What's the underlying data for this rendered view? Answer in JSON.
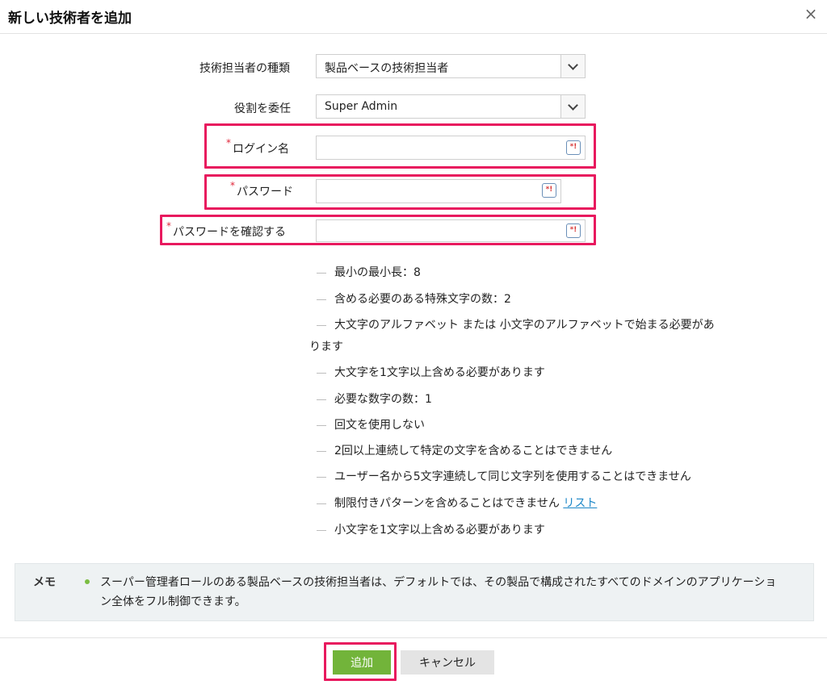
{
  "dialog": {
    "title": "新しい技術者を追加",
    "close_label": "×"
  },
  "form": {
    "tech_type_label": "技術担当者の種類",
    "tech_type_value": "製品ベースの技術担当者",
    "role_label": "役割を委任",
    "role_value": "Super Admin",
    "login_label": "ログイン名",
    "password_label": "パスワード",
    "confirm_label": "パスワードを確認する",
    "required_mark": "*",
    "key_icon_glyph": "*!"
  },
  "rules": [
    "最小の最小長：8",
    "含める必要のある特殊文字の数：2",
    "大文字のアルファベット または 小文字のアルファベットで始まる必要があ",
    "ります",
    "大文字を1文字以上含める必要があります",
    "必要な数字の数：1",
    "回文を使用しない",
    "2回以上連続して特定の文字を含めることはできません",
    "ユーザー名から5文字連続して同じ文字列を使用することはできません",
    "制限付きパターンを含めることはできません",
    "小文字を1文字以上含める必要があります"
  ],
  "rules_link": "リスト",
  "memo": {
    "label": "メモ",
    "text": "スーパー管理者ロールのある製品ベースの技術担当者は、デフォルトでは、その製品で構成されたすべてのドメインのアプリケーション全体をフル制御できます。"
  },
  "buttons": {
    "add": "追加",
    "cancel": "キャンセル"
  },
  "colors": {
    "highlight": "#e8195e",
    "add_button": "#72b43a",
    "link": "#1e88c8",
    "required": "#e0263a"
  }
}
